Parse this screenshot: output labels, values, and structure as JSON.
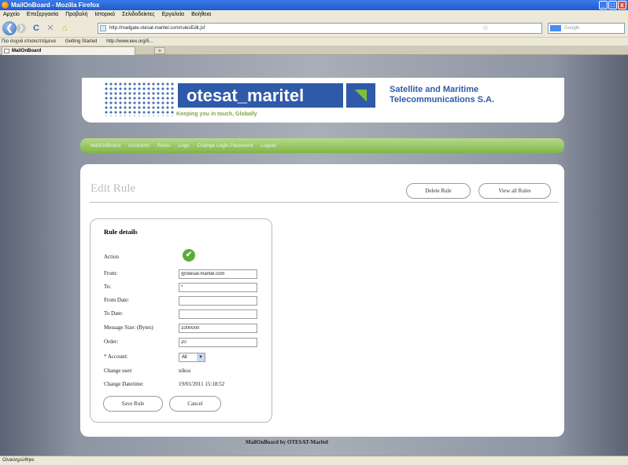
{
  "window": {
    "title": "MailOnBoard - Mozilla Firefox",
    "minimize_glyph": "_",
    "maximize_glyph": "□",
    "close_glyph": "x"
  },
  "browser": {
    "menu": [
      "Αρχείο",
      "Επεξεργασία",
      "Προβολή",
      "Ιστορικό",
      "Σελιδοδείκτες",
      "Εργαλεία",
      "Βοήθεια"
    ],
    "back_glyph": "❮",
    "forward_glyph": "❯",
    "reload_glyph": "C",
    "stop_glyph": "✕",
    "home_glyph": "⌂",
    "url": "http://mailgate.otesat-maritel.com/rulesEdit.jsf",
    "star_glyph": "☆",
    "search_placeholder": "Google",
    "bookmarks": [
      "Πιο συχνά επισκεπτόμενα",
      "Getting Started",
      "http://www.eex.org/5..."
    ],
    "tab_title": "MailOnBoard",
    "new_tab_glyph": "+",
    "status_text": "Ολοκληρώθηκε"
  },
  "site": {
    "logo_text": "otesat_maritel",
    "logo_signal_glyph": "◥",
    "tagline": "Keeping you in touch, Globally",
    "company_name": "Satellite and Maritime Telecommunications S.A.",
    "nav": [
      "MailOnBoard",
      "Accounts",
      "Rules",
      "Logs",
      "Change Login Password",
      "Logout"
    ],
    "footer": "MailOnBoard by OTESAT-Maritel"
  },
  "page": {
    "title": "Edit Rule",
    "delete_button": "Delete Rule",
    "view_all_button": "View all Rules",
    "details_heading": "Rule details",
    "action_label": "Action",
    "action_glyph": "✔",
    "from_label": "From:",
    "from_value": "@otesat-maritel.com",
    "to_label": "To:",
    "to_value": "*",
    "from_date_label": "From Date:",
    "from_date_value": "",
    "to_date_label": "To Date:",
    "to_date_value": "",
    "size_label": "Message Size: (Bytes)",
    "size_value": "1000000",
    "order_label": "Order:",
    "order_value": "20",
    "account_label": "* Account:",
    "account_value": "All",
    "select_arrow_glyph": "▼",
    "change_user_label": "Change user:",
    "change_user_value": "nikos",
    "change_datetime_label": "Change Datetime:",
    "change_datetime_value": "19/01/2011 15:18:52",
    "save_button": "Save Rule",
    "cancel_button": "Cancel"
  },
  "colors": {
    "site_blue": "#2f5aa9",
    "nav_green": "#7fb548",
    "success_green": "#5aab3c"
  }
}
